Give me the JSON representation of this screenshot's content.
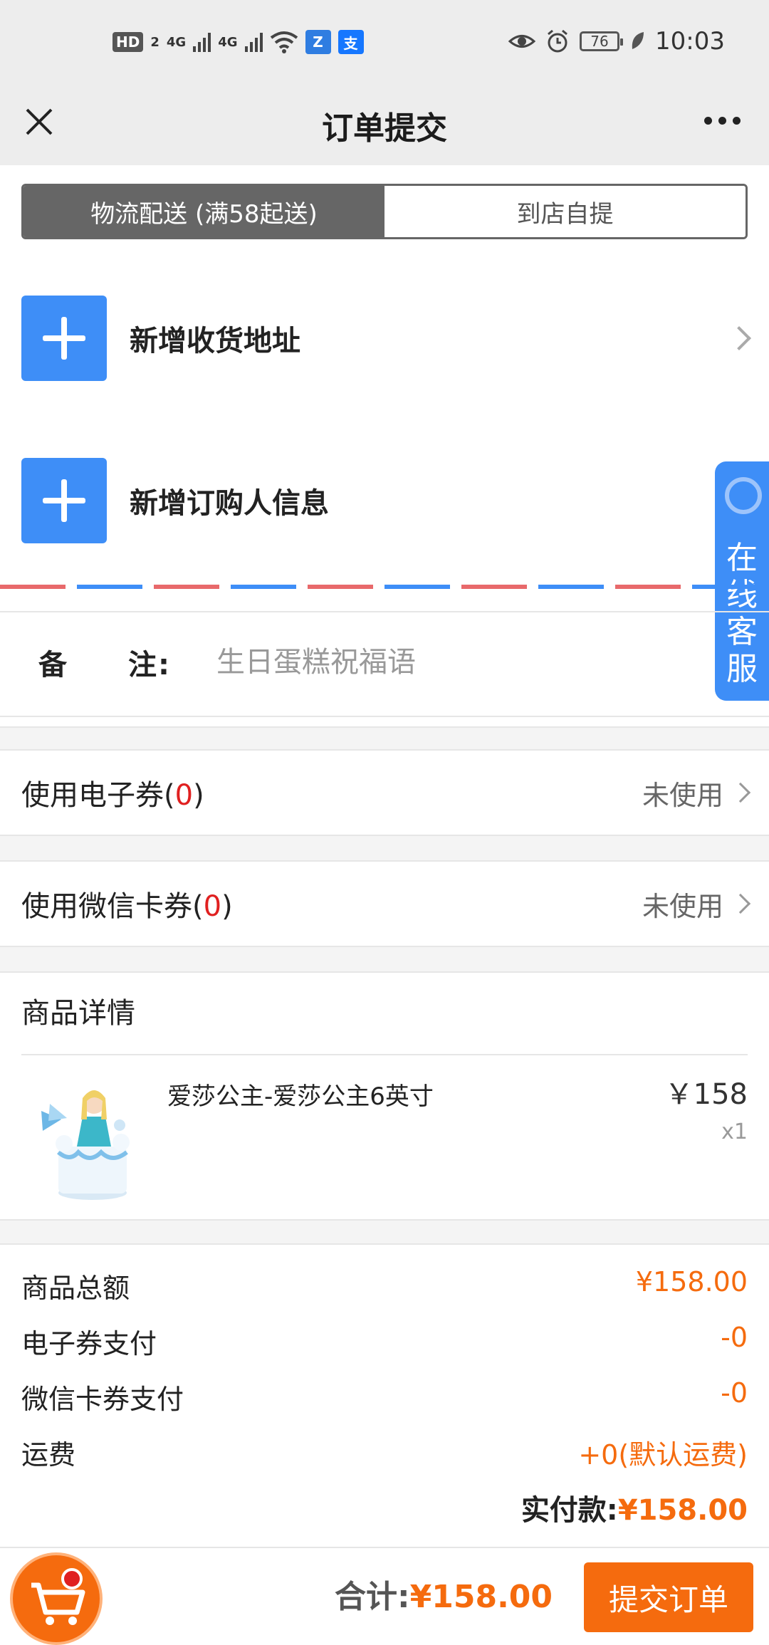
{
  "status_bar": {
    "left_icons": [
      "hd-icon",
      "signal-4g-icon",
      "signal-4g-icon",
      "wifi-icon",
      "app-icon",
      "alipay-icon"
    ],
    "hd_label": "HD",
    "hd_sub": "2",
    "net1": "4G",
    "net2": "4G",
    "battery": "76",
    "time": "10:03"
  },
  "nav": {
    "title": "订单提交"
  },
  "tabs": [
    {
      "label": "物流配送 (满58起送)",
      "active": true
    },
    {
      "label": "到店自提",
      "active": false
    }
  ],
  "address": {
    "label": "新增收货地址"
  },
  "buyer": {
    "label": "新增订购人信息"
  },
  "service": {
    "label": "在线客服"
  },
  "note": {
    "label": "备　　注:",
    "placeholder": "生日蛋糕祝福语"
  },
  "coupons": {
    "e_coupon": {
      "prefix": "使用电子券(",
      "count": "0",
      "suffix": ")",
      "value": "未使用"
    },
    "wx_coupon": {
      "prefix": "使用微信卡券(",
      "count": "0",
      "suffix": ")",
      "value": "未使用"
    }
  },
  "product_section": {
    "title": "商品详情",
    "items": [
      {
        "name": "爱莎公主-爱莎公主6英寸",
        "price": "￥158",
        "qty": "x1"
      }
    ]
  },
  "summary": {
    "rows": [
      {
        "label": "商品总额",
        "value": "¥158.00"
      },
      {
        "label": "电子券支付",
        "value": "-0"
      },
      {
        "label": "微信卡券支付",
        "value": "-0"
      },
      {
        "label": "运费",
        "value": "+0(默认运费)"
      }
    ],
    "paid_label": "实付款:",
    "paid_value": "¥158.00"
  },
  "bottom": {
    "total_label": "合计:",
    "total_value": "¥158.00",
    "submit_label": "提交订单"
  },
  "colors": {
    "accent_orange": "#f56b0e",
    "accent_blue": "#3e8ef7",
    "count_red": "#e02020"
  }
}
